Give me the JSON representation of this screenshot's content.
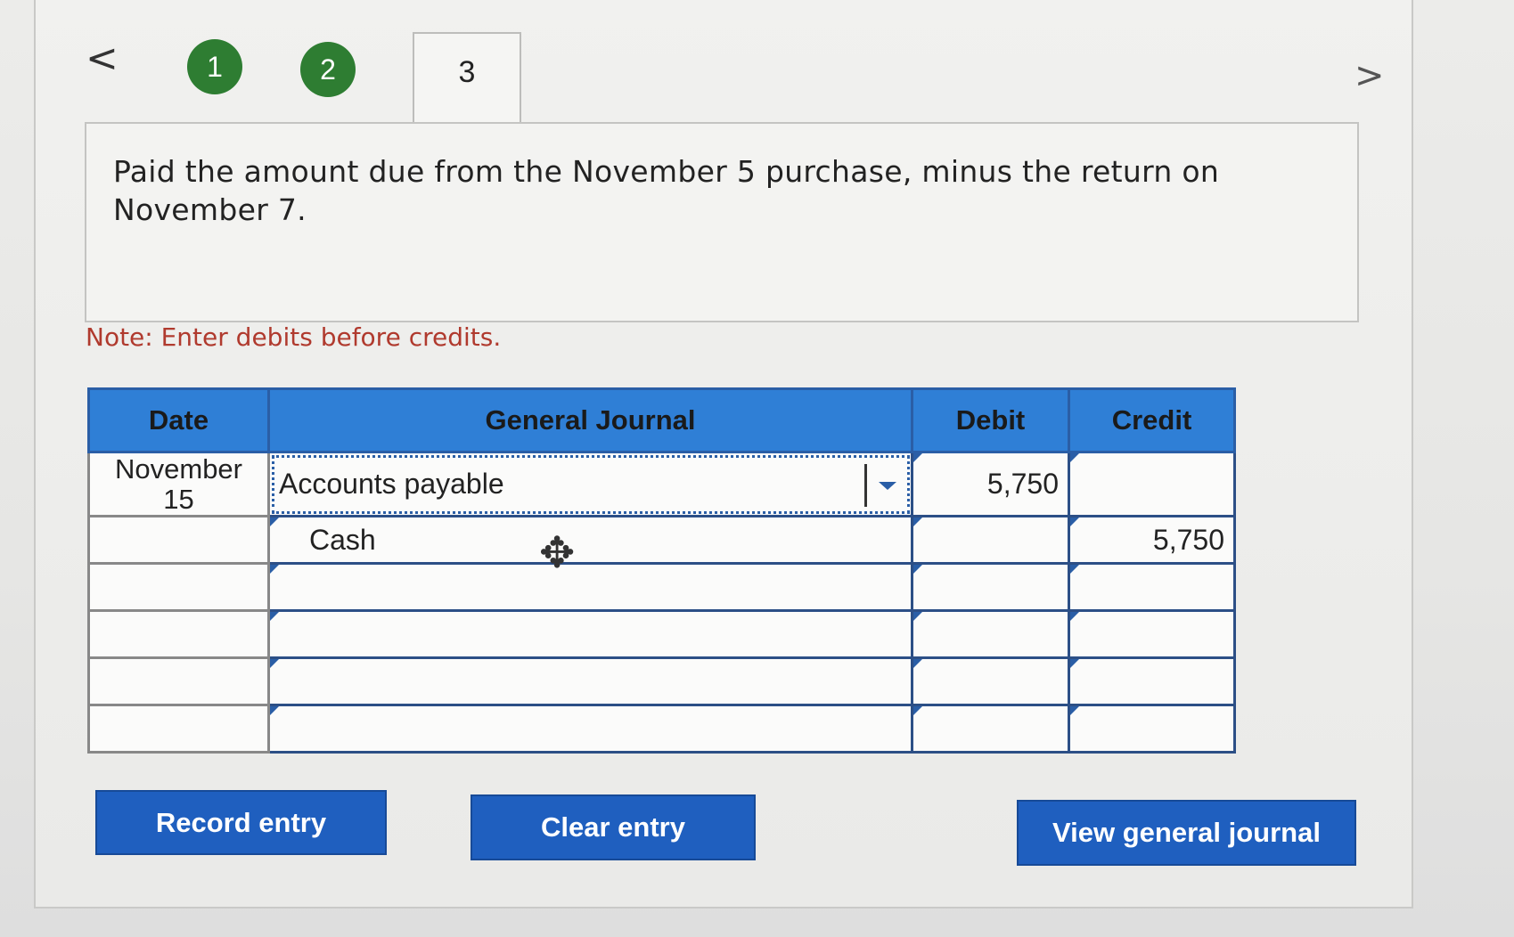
{
  "nav": {
    "prev": "<",
    "next": ">",
    "steps": [
      "1",
      "2",
      "3"
    ]
  },
  "prompt": {
    "text": "Paid the amount due from the November 5 purchase, minus the return on November 7."
  },
  "note": "Note: Enter debits before credits.",
  "journal": {
    "headers": {
      "date": "Date",
      "general_journal": "General Journal",
      "debit": "Debit",
      "credit": "Credit"
    },
    "rows": [
      {
        "date": "November\n15",
        "account": "Accounts payable",
        "debit": "5,750",
        "credit": ""
      },
      {
        "date": "",
        "account": "Cash",
        "debit": "",
        "credit": "5,750"
      },
      {
        "date": "",
        "account": "",
        "debit": "",
        "credit": ""
      },
      {
        "date": "",
        "account": "",
        "debit": "",
        "credit": ""
      },
      {
        "date": "",
        "account": "",
        "debit": "",
        "credit": ""
      },
      {
        "date": "",
        "account": "",
        "debit": "",
        "credit": ""
      }
    ]
  },
  "buttons": {
    "record": "Record entry",
    "clear": "Clear entry",
    "view": "View general journal"
  },
  "colors": {
    "step_complete": "#2e7d32",
    "header_bg": "#2f7fd6",
    "button_bg": "#1f5fbf",
    "note_text": "#b03a2e"
  }
}
